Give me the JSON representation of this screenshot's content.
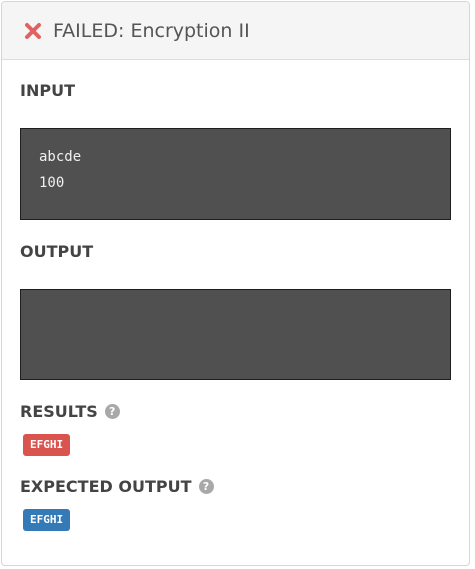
{
  "header": {
    "status_icon": "close-icon",
    "title": "FAILED: Encryption II",
    "status_color": "#e05a5a"
  },
  "input": {
    "label": "INPUT",
    "lines": [
      "abcde",
      "100"
    ]
  },
  "output": {
    "label": "OUTPUT",
    "lines": []
  },
  "results": {
    "label": "RESULTS",
    "help_icon": "question-circle-icon",
    "value": "EFGHI",
    "badge_color": "#d9534f"
  },
  "expected": {
    "label": "EXPECTED OUTPUT",
    "help_icon": "question-circle-icon",
    "value": "EFGHI",
    "badge_color": "#337ab7"
  }
}
